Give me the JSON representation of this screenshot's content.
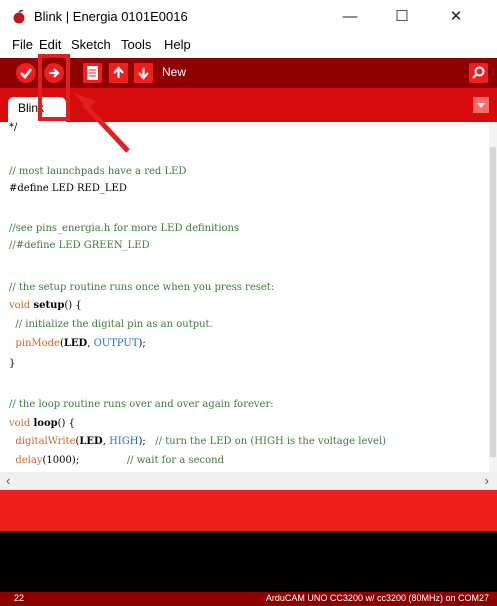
{
  "window": {
    "title": "Blink | Energia 0101E0016",
    "minimize_glyph": "—",
    "maximize_glyph": "☐",
    "close_glyph": "✕"
  },
  "menu": [
    "File",
    "Edit",
    "Sketch",
    "Tools",
    "Help"
  ],
  "toolbar": {
    "hover_label": "New",
    "buttons": [
      "verify",
      "upload",
      "new",
      "open",
      "save"
    ],
    "serial_monitor_icon": "magnifier-icon"
  },
  "tabs": [
    {
      "label": "Blink"
    }
  ],
  "code": {
    "lines": [
      "*/",
      "",
      "// most launchpads have a red LED",
      "#define LED RED_LED",
      "",
      "//see pins_energia.h for more LED definitions",
      "//#define LED GREEN_LED",
      "",
      "// the setup routine runs once when you press reset:",
      "void setup() {",
      "  // initialize the digital pin as an output.",
      "  pinMode(LED, OUTPUT);",
      "}",
      "",
      "// the loop routine runs over and over again forever:",
      "void loop() {",
      "  digitalWrite(LED, HIGH);   // turn the LED on (HIGH is the voltage level)",
      "  delay(1000);               // wait for a second"
    ]
  },
  "status": {
    "line_number": "22",
    "board": "ArduCAM UNO CC3200 w/ cc3200 (80MHz) on COM27"
  },
  "colors": {
    "toolbar": "#8f0000",
    "tabbar": "#d60b0b",
    "button": "#ef1f1f",
    "annotation": "#e02020"
  }
}
